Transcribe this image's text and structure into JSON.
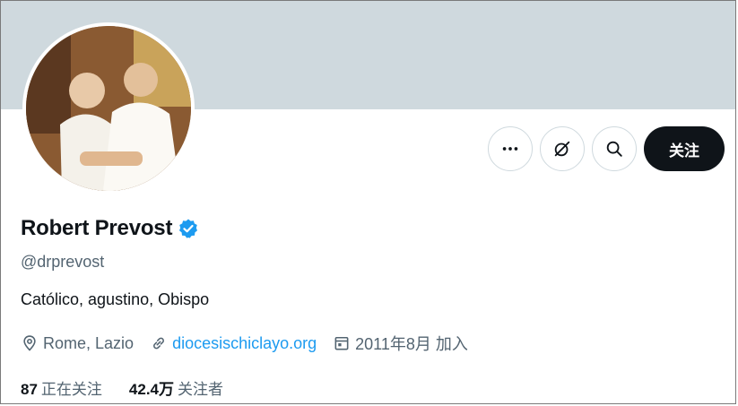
{
  "profile": {
    "name": "Robert Prevost",
    "handle": "@drprevost",
    "bio": "Católico, agustino, Obispo",
    "location": "Rome, Lazio",
    "website": "diocesischiclayo.org",
    "joined": "2011年8月 加入",
    "verified": true
  },
  "actions": {
    "follow_label": "关注"
  },
  "stats": {
    "following_count": "87",
    "following_label": "正在关注",
    "followers_count": "42.4万",
    "followers_label": "关注者"
  },
  "colors": {
    "banner": "#cfd9de",
    "verified_badge": "#1d9bf0",
    "link": "#1d9bf0",
    "follow_button": "#0f1419"
  },
  "icons": [
    "more-icon",
    "grok-icon",
    "search-icon",
    "verified-badge-icon",
    "location-icon",
    "link-icon",
    "calendar-icon"
  ]
}
